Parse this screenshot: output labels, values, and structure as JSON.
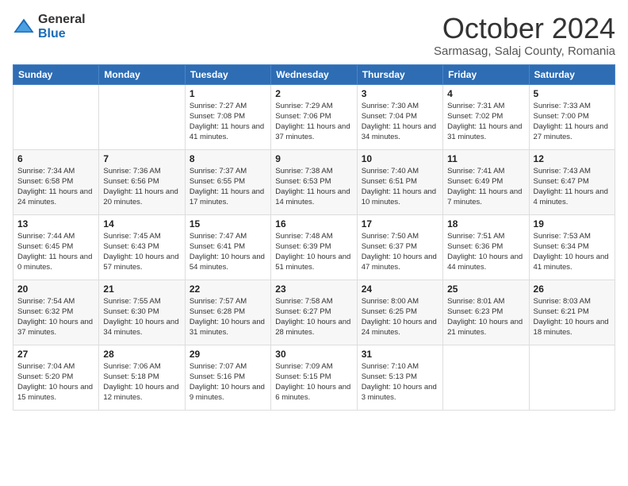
{
  "logo": {
    "general": "General",
    "blue": "Blue"
  },
  "title": "October 2024",
  "subtitle": "Sarmasag, Salaj County, Romania",
  "weekdays": [
    "Sunday",
    "Monday",
    "Tuesday",
    "Wednesday",
    "Thursday",
    "Friday",
    "Saturday"
  ],
  "weeks": [
    [
      {
        "day": "",
        "info": ""
      },
      {
        "day": "",
        "info": ""
      },
      {
        "day": "1",
        "info": "Sunrise: 7:27 AM\nSunset: 7:08 PM\nDaylight: 11 hours and 41 minutes."
      },
      {
        "day": "2",
        "info": "Sunrise: 7:29 AM\nSunset: 7:06 PM\nDaylight: 11 hours and 37 minutes."
      },
      {
        "day": "3",
        "info": "Sunrise: 7:30 AM\nSunset: 7:04 PM\nDaylight: 11 hours and 34 minutes."
      },
      {
        "day": "4",
        "info": "Sunrise: 7:31 AM\nSunset: 7:02 PM\nDaylight: 11 hours and 31 minutes."
      },
      {
        "day": "5",
        "info": "Sunrise: 7:33 AM\nSunset: 7:00 PM\nDaylight: 11 hours and 27 minutes."
      }
    ],
    [
      {
        "day": "6",
        "info": "Sunrise: 7:34 AM\nSunset: 6:58 PM\nDaylight: 11 hours and 24 minutes."
      },
      {
        "day": "7",
        "info": "Sunrise: 7:36 AM\nSunset: 6:56 PM\nDaylight: 11 hours and 20 minutes."
      },
      {
        "day": "8",
        "info": "Sunrise: 7:37 AM\nSunset: 6:55 PM\nDaylight: 11 hours and 17 minutes."
      },
      {
        "day": "9",
        "info": "Sunrise: 7:38 AM\nSunset: 6:53 PM\nDaylight: 11 hours and 14 minutes."
      },
      {
        "day": "10",
        "info": "Sunrise: 7:40 AM\nSunset: 6:51 PM\nDaylight: 11 hours and 10 minutes."
      },
      {
        "day": "11",
        "info": "Sunrise: 7:41 AM\nSunset: 6:49 PM\nDaylight: 11 hours and 7 minutes."
      },
      {
        "day": "12",
        "info": "Sunrise: 7:43 AM\nSunset: 6:47 PM\nDaylight: 11 hours and 4 minutes."
      }
    ],
    [
      {
        "day": "13",
        "info": "Sunrise: 7:44 AM\nSunset: 6:45 PM\nDaylight: 11 hours and 0 minutes."
      },
      {
        "day": "14",
        "info": "Sunrise: 7:45 AM\nSunset: 6:43 PM\nDaylight: 10 hours and 57 minutes."
      },
      {
        "day": "15",
        "info": "Sunrise: 7:47 AM\nSunset: 6:41 PM\nDaylight: 10 hours and 54 minutes."
      },
      {
        "day": "16",
        "info": "Sunrise: 7:48 AM\nSunset: 6:39 PM\nDaylight: 10 hours and 51 minutes."
      },
      {
        "day": "17",
        "info": "Sunrise: 7:50 AM\nSunset: 6:37 PM\nDaylight: 10 hours and 47 minutes."
      },
      {
        "day": "18",
        "info": "Sunrise: 7:51 AM\nSunset: 6:36 PM\nDaylight: 10 hours and 44 minutes."
      },
      {
        "day": "19",
        "info": "Sunrise: 7:53 AM\nSunset: 6:34 PM\nDaylight: 10 hours and 41 minutes."
      }
    ],
    [
      {
        "day": "20",
        "info": "Sunrise: 7:54 AM\nSunset: 6:32 PM\nDaylight: 10 hours and 37 minutes."
      },
      {
        "day": "21",
        "info": "Sunrise: 7:55 AM\nSunset: 6:30 PM\nDaylight: 10 hours and 34 minutes."
      },
      {
        "day": "22",
        "info": "Sunrise: 7:57 AM\nSunset: 6:28 PM\nDaylight: 10 hours and 31 minutes."
      },
      {
        "day": "23",
        "info": "Sunrise: 7:58 AM\nSunset: 6:27 PM\nDaylight: 10 hours and 28 minutes."
      },
      {
        "day": "24",
        "info": "Sunrise: 8:00 AM\nSunset: 6:25 PM\nDaylight: 10 hours and 24 minutes."
      },
      {
        "day": "25",
        "info": "Sunrise: 8:01 AM\nSunset: 6:23 PM\nDaylight: 10 hours and 21 minutes."
      },
      {
        "day": "26",
        "info": "Sunrise: 8:03 AM\nSunset: 6:21 PM\nDaylight: 10 hours and 18 minutes."
      }
    ],
    [
      {
        "day": "27",
        "info": "Sunrise: 7:04 AM\nSunset: 5:20 PM\nDaylight: 10 hours and 15 minutes."
      },
      {
        "day": "28",
        "info": "Sunrise: 7:06 AM\nSunset: 5:18 PM\nDaylight: 10 hours and 12 minutes."
      },
      {
        "day": "29",
        "info": "Sunrise: 7:07 AM\nSunset: 5:16 PM\nDaylight: 10 hours and 9 minutes."
      },
      {
        "day": "30",
        "info": "Sunrise: 7:09 AM\nSunset: 5:15 PM\nDaylight: 10 hours and 6 minutes."
      },
      {
        "day": "31",
        "info": "Sunrise: 7:10 AM\nSunset: 5:13 PM\nDaylight: 10 hours and 3 minutes."
      },
      {
        "day": "",
        "info": ""
      },
      {
        "day": "",
        "info": ""
      }
    ]
  ]
}
